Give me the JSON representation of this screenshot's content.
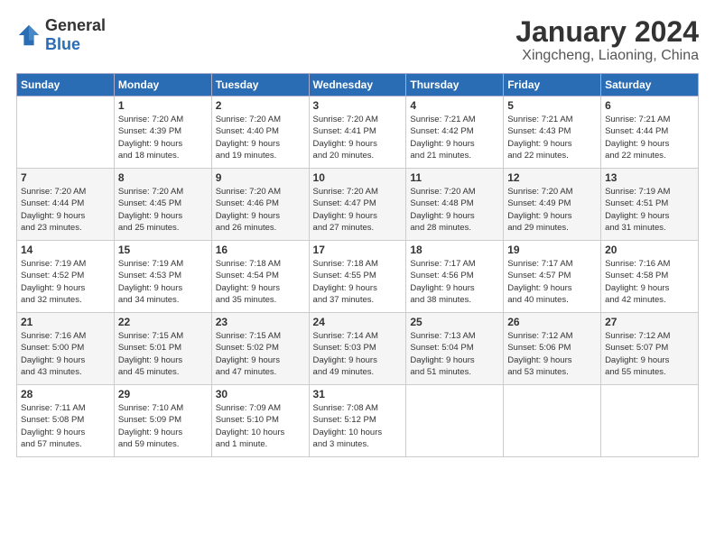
{
  "logo": {
    "general": "General",
    "blue": "Blue"
  },
  "header": {
    "title": "January 2024",
    "subtitle": "Xingcheng, Liaoning, China"
  },
  "weekdays": [
    "Sunday",
    "Monday",
    "Tuesday",
    "Wednesday",
    "Thursday",
    "Friday",
    "Saturday"
  ],
  "weeks": [
    [
      {
        "day": "",
        "info": ""
      },
      {
        "day": "1",
        "info": "Sunrise: 7:20 AM\nSunset: 4:39 PM\nDaylight: 9 hours\nand 18 minutes."
      },
      {
        "day": "2",
        "info": "Sunrise: 7:20 AM\nSunset: 4:40 PM\nDaylight: 9 hours\nand 19 minutes."
      },
      {
        "day": "3",
        "info": "Sunrise: 7:20 AM\nSunset: 4:41 PM\nDaylight: 9 hours\nand 20 minutes."
      },
      {
        "day": "4",
        "info": "Sunrise: 7:21 AM\nSunset: 4:42 PM\nDaylight: 9 hours\nand 21 minutes."
      },
      {
        "day": "5",
        "info": "Sunrise: 7:21 AM\nSunset: 4:43 PM\nDaylight: 9 hours\nand 22 minutes."
      },
      {
        "day": "6",
        "info": "Sunrise: 7:21 AM\nSunset: 4:44 PM\nDaylight: 9 hours\nand 22 minutes."
      }
    ],
    [
      {
        "day": "7",
        "info": "Sunrise: 7:20 AM\nSunset: 4:44 PM\nDaylight: 9 hours\nand 23 minutes."
      },
      {
        "day": "8",
        "info": "Sunrise: 7:20 AM\nSunset: 4:45 PM\nDaylight: 9 hours\nand 25 minutes."
      },
      {
        "day": "9",
        "info": "Sunrise: 7:20 AM\nSunset: 4:46 PM\nDaylight: 9 hours\nand 26 minutes."
      },
      {
        "day": "10",
        "info": "Sunrise: 7:20 AM\nSunset: 4:47 PM\nDaylight: 9 hours\nand 27 minutes."
      },
      {
        "day": "11",
        "info": "Sunrise: 7:20 AM\nSunset: 4:48 PM\nDaylight: 9 hours\nand 28 minutes."
      },
      {
        "day": "12",
        "info": "Sunrise: 7:20 AM\nSunset: 4:49 PM\nDaylight: 9 hours\nand 29 minutes."
      },
      {
        "day": "13",
        "info": "Sunrise: 7:19 AM\nSunset: 4:51 PM\nDaylight: 9 hours\nand 31 minutes."
      }
    ],
    [
      {
        "day": "14",
        "info": "Sunrise: 7:19 AM\nSunset: 4:52 PM\nDaylight: 9 hours\nand 32 minutes."
      },
      {
        "day": "15",
        "info": "Sunrise: 7:19 AM\nSunset: 4:53 PM\nDaylight: 9 hours\nand 34 minutes."
      },
      {
        "day": "16",
        "info": "Sunrise: 7:18 AM\nSunset: 4:54 PM\nDaylight: 9 hours\nand 35 minutes."
      },
      {
        "day": "17",
        "info": "Sunrise: 7:18 AM\nSunset: 4:55 PM\nDaylight: 9 hours\nand 37 minutes."
      },
      {
        "day": "18",
        "info": "Sunrise: 7:17 AM\nSunset: 4:56 PM\nDaylight: 9 hours\nand 38 minutes."
      },
      {
        "day": "19",
        "info": "Sunrise: 7:17 AM\nSunset: 4:57 PM\nDaylight: 9 hours\nand 40 minutes."
      },
      {
        "day": "20",
        "info": "Sunrise: 7:16 AM\nSunset: 4:58 PM\nDaylight: 9 hours\nand 42 minutes."
      }
    ],
    [
      {
        "day": "21",
        "info": "Sunrise: 7:16 AM\nSunset: 5:00 PM\nDaylight: 9 hours\nand 43 minutes."
      },
      {
        "day": "22",
        "info": "Sunrise: 7:15 AM\nSunset: 5:01 PM\nDaylight: 9 hours\nand 45 minutes."
      },
      {
        "day": "23",
        "info": "Sunrise: 7:15 AM\nSunset: 5:02 PM\nDaylight: 9 hours\nand 47 minutes."
      },
      {
        "day": "24",
        "info": "Sunrise: 7:14 AM\nSunset: 5:03 PM\nDaylight: 9 hours\nand 49 minutes."
      },
      {
        "day": "25",
        "info": "Sunrise: 7:13 AM\nSunset: 5:04 PM\nDaylight: 9 hours\nand 51 minutes."
      },
      {
        "day": "26",
        "info": "Sunrise: 7:12 AM\nSunset: 5:06 PM\nDaylight: 9 hours\nand 53 minutes."
      },
      {
        "day": "27",
        "info": "Sunrise: 7:12 AM\nSunset: 5:07 PM\nDaylight: 9 hours\nand 55 minutes."
      }
    ],
    [
      {
        "day": "28",
        "info": "Sunrise: 7:11 AM\nSunset: 5:08 PM\nDaylight: 9 hours\nand 57 minutes."
      },
      {
        "day": "29",
        "info": "Sunrise: 7:10 AM\nSunset: 5:09 PM\nDaylight: 9 hours\nand 59 minutes."
      },
      {
        "day": "30",
        "info": "Sunrise: 7:09 AM\nSunset: 5:10 PM\nDaylight: 10 hours\nand 1 minute."
      },
      {
        "day": "31",
        "info": "Sunrise: 7:08 AM\nSunset: 5:12 PM\nDaylight: 10 hours\nand 3 minutes."
      },
      {
        "day": "",
        "info": ""
      },
      {
        "day": "",
        "info": ""
      },
      {
        "day": "",
        "info": ""
      }
    ]
  ]
}
